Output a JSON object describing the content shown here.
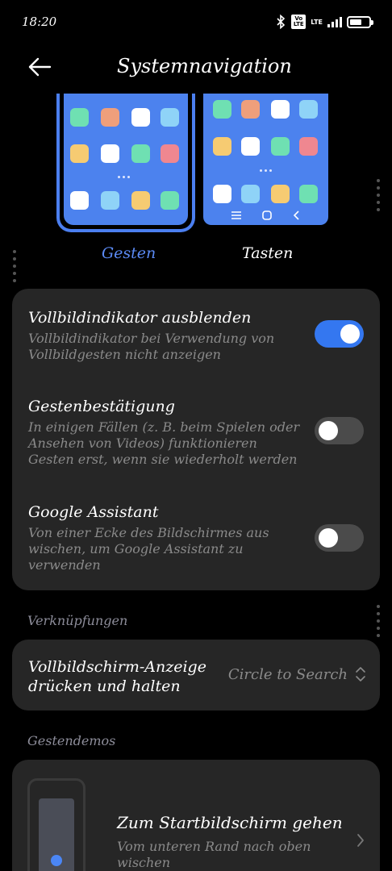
{
  "status_bar": {
    "time": "18:20",
    "volte": "Vo LTE",
    "network": "LTE"
  },
  "header": {
    "title": "Systemnavigation",
    "back_icon": "arrow-left-icon"
  },
  "nav_modes": [
    {
      "label": "Gesten",
      "selected": true
    },
    {
      "label": "Tasten",
      "selected": false
    }
  ],
  "settings": [
    {
      "title": "Vollbildindikator ausblenden",
      "subtitle": "Vollbildindikator bei Verwendung von Vollbildgesten nicht anzeigen",
      "enabled": true
    },
    {
      "title": "Gestenbestätigung",
      "subtitle": "In einigen Fällen (z. B. beim Spielen oder Ansehen von Videos) funktionieren Gesten erst, wenn sie wiederholt werden",
      "enabled": false
    },
    {
      "title": "Google Assistant",
      "subtitle": "Von einer Ecke des Bildschirmes aus wischen, um Google Assistant zu verwenden",
      "enabled": false
    }
  ],
  "shortcuts": {
    "section_label": "Verknüpfungen",
    "item_title": "Vollbildschirm-Anzeige drücken und halten",
    "item_value": "Circle to Search"
  },
  "demos": {
    "section_label": "Gestendemos",
    "item_title": "Zum Startbildschirm gehen",
    "item_subtitle": "Vom unteren Rand nach oben wischen"
  },
  "colors": {
    "accent": "#3477f0",
    "selected_label": "#5b8af4",
    "card_bg": "#262626",
    "preview_bg": "#4c82ee"
  }
}
